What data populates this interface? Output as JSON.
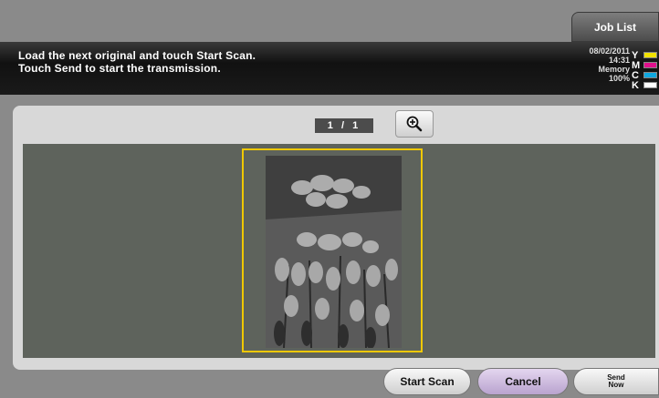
{
  "header": {
    "job_list_label": "Job List"
  },
  "message": {
    "line1": "Load the next original and touch Start Scan.",
    "line2": "Touch Send to start the transmission."
  },
  "status": {
    "date": "08/02/2011",
    "time": "14:31",
    "memory_label": "Memory",
    "memory_value": "100%"
  },
  "toner": [
    {
      "label": "Y",
      "color": "#f2e200"
    },
    {
      "label": "M",
      "color": "#e0108c"
    },
    {
      "label": "C",
      "color": "#10a8e0"
    },
    {
      "label": "K",
      "color": "#ffffff"
    }
  ],
  "preview": {
    "page_indicator": "1 / 1",
    "zoom_icon": "zoom-in-icon"
  },
  "buttons": {
    "start_scan": "Start Scan",
    "cancel": "Cancel",
    "send_now_line1": "Send",
    "send_now_line2": "Now"
  }
}
